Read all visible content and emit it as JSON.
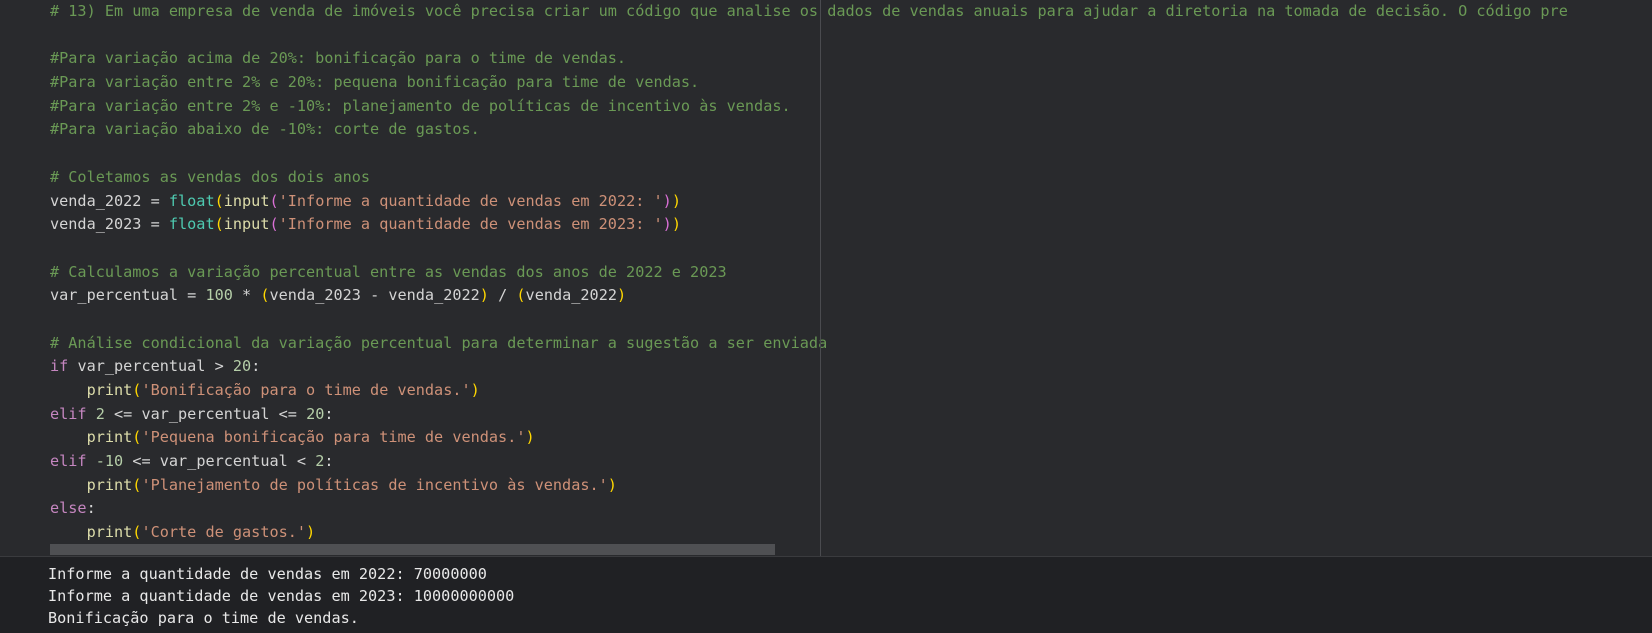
{
  "editor": {
    "lines": [
      [
        {
          "t": "# 13) Em uma empresa de venda de imóveis você precisa criar um código que analise os dados de vendas anuais para ajudar a diretoria na tomada de decisão. O código pre",
          "c": "comment"
        }
      ],
      [],
      [
        {
          "t": "#Para variação acima de 20%: bonificação para o time de vendas.",
          "c": "comment"
        }
      ],
      [
        {
          "t": "#Para variação entre 2% e 20%: pequena bonificação para time de vendas.",
          "c": "comment"
        }
      ],
      [
        {
          "t": "#Para variação entre 2% e -10%: planejamento de políticas de incentivo às vendas.",
          "c": "comment"
        }
      ],
      [
        {
          "t": "#Para variação abaixo de -10%: corte de gastos.",
          "c": "comment"
        }
      ],
      [],
      [
        {
          "t": "# Coletamos as vendas dos dois anos",
          "c": "comment"
        }
      ],
      [
        {
          "t": "venda_2022",
          "c": "var"
        },
        {
          "t": " = ",
          "c": "op"
        },
        {
          "t": "float",
          "c": "builtin"
        },
        {
          "t": "(",
          "c": "p1"
        },
        {
          "t": "input",
          "c": "fn"
        },
        {
          "t": "(",
          "c": "p2"
        },
        {
          "t": "'Informe a quantidade de vendas em 2022: '",
          "c": "str"
        },
        {
          "t": ")",
          "c": "p2"
        },
        {
          "t": ")",
          "c": "p1"
        }
      ],
      [
        {
          "t": "venda_2023",
          "c": "var"
        },
        {
          "t": " = ",
          "c": "op"
        },
        {
          "t": "float",
          "c": "builtin"
        },
        {
          "t": "(",
          "c": "p1"
        },
        {
          "t": "input",
          "c": "fn"
        },
        {
          "t": "(",
          "c": "p2"
        },
        {
          "t": "'Informe a quantidade de vendas em 2023: '",
          "c": "str"
        },
        {
          "t": ")",
          "c": "p2"
        },
        {
          "t": ")",
          "c": "p1"
        }
      ],
      [],
      [
        {
          "t": "# Calculamos a variação percentual entre as vendas dos anos de 2022 e 2023",
          "c": "comment"
        }
      ],
      [
        {
          "t": "var_percentual",
          "c": "var"
        },
        {
          "t": " = ",
          "c": "op"
        },
        {
          "t": "100",
          "c": "num"
        },
        {
          "t": " * ",
          "c": "op"
        },
        {
          "t": "(",
          "c": "p1"
        },
        {
          "t": "venda_2023 - venda_2022",
          "c": "var"
        },
        {
          "t": ")",
          "c": "p1"
        },
        {
          "t": " / ",
          "c": "op"
        },
        {
          "t": "(",
          "c": "p1"
        },
        {
          "t": "venda_2022",
          "c": "var"
        },
        {
          "t": ")",
          "c": "p1"
        }
      ],
      [],
      [
        {
          "t": "# Análise condicional da variação percentual para determinar a sugestão a ser enviada",
          "c": "comment"
        }
      ],
      [
        {
          "t": "if",
          "c": "kw"
        },
        {
          "t": " var_percentual > ",
          "c": "var"
        },
        {
          "t": "20",
          "c": "num"
        },
        {
          "t": ":",
          "c": "op"
        }
      ],
      [
        {
          "t": "    ",
          "c": "op"
        },
        {
          "t": "print",
          "c": "fn"
        },
        {
          "t": "(",
          "c": "p1"
        },
        {
          "t": "'Bonificação para o time de vendas.'",
          "c": "str"
        },
        {
          "t": ")",
          "c": "p1"
        }
      ],
      [
        {
          "t": "elif",
          "c": "kw"
        },
        {
          "t": " ",
          "c": "op"
        },
        {
          "t": "2",
          "c": "num"
        },
        {
          "t": " <= var_percentual <= ",
          "c": "var"
        },
        {
          "t": "20",
          "c": "num"
        },
        {
          "t": ":",
          "c": "op"
        }
      ],
      [
        {
          "t": "    ",
          "c": "op"
        },
        {
          "t": "print",
          "c": "fn"
        },
        {
          "t": "(",
          "c": "p1"
        },
        {
          "t": "'Pequena bonificação para time de vendas.'",
          "c": "str"
        },
        {
          "t": ")",
          "c": "p1"
        }
      ],
      [
        {
          "t": "elif",
          "c": "kw"
        },
        {
          "t": " ",
          "c": "op"
        },
        {
          "t": "-10",
          "c": "num"
        },
        {
          "t": " <= var_percentual < ",
          "c": "var"
        },
        {
          "t": "2",
          "c": "num"
        },
        {
          "t": ":",
          "c": "op"
        }
      ],
      [
        {
          "t": "    ",
          "c": "op"
        },
        {
          "t": "print",
          "c": "fn"
        },
        {
          "t": "(",
          "c": "p1"
        },
        {
          "t": "'Planejamento de políticas de incentivo às vendas.'",
          "c": "str"
        },
        {
          "t": ")",
          "c": "p1"
        }
      ],
      [
        {
          "t": "else",
          "c": "kw"
        },
        {
          "t": ":",
          "c": "op"
        }
      ],
      [
        {
          "t": "    ",
          "c": "op"
        },
        {
          "t": "print",
          "c": "fn"
        },
        {
          "t": "(",
          "c": "p1"
        },
        {
          "t": "'Corte de gastos.'",
          "c": "str"
        },
        {
          "t": ")",
          "c": "p1"
        }
      ]
    ]
  },
  "output": {
    "lines": [
      "Informe a quantidade de vendas em 2022: 70000000",
      "Informe a quantidade de vendas em 2023: 10000000000",
      "Bonificação para o time de vendas."
    ]
  },
  "colors": {
    "comment": "#6a9955",
    "keyword": "#c586c0",
    "function": "#dcdcaa",
    "builtin": "#4ec9b0",
    "string": "#ce9178",
    "number": "#b5cea8",
    "bracket_1": "#ffd700",
    "bracket_2": "#da70d6",
    "editor_background": "#292a2d",
    "output_background": "#202124"
  }
}
